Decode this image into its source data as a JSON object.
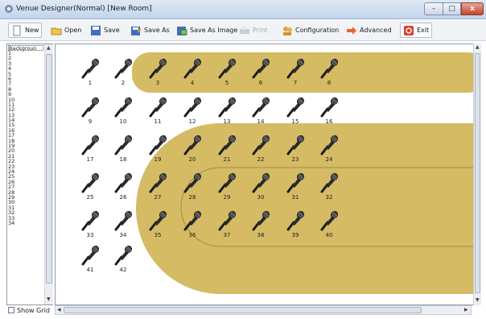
{
  "window": {
    "title": "Venue Designer(Normal) [New Room]",
    "min_label": "–",
    "max_label": "□",
    "close_label": "x"
  },
  "toolbar": [
    {
      "label": "New",
      "icon": "new-document-icon",
      "name": "new-button",
      "boxed": true
    },
    {
      "label": "Open",
      "icon": "open-folder-icon",
      "name": "open-button",
      "boxed": false
    },
    {
      "label": "Save",
      "icon": "save-disk-icon",
      "name": "save-button",
      "boxed": false
    },
    {
      "label": "Save As",
      "icon": "save-as-icon",
      "name": "save-as-button",
      "boxed": false
    },
    {
      "label": "Save As Image",
      "icon": "save-as-image-icon",
      "name": "save-as-image-button",
      "boxed": false
    },
    {
      "label": "Print",
      "icon": "printer-icon",
      "name": "print-button",
      "boxed": false,
      "disabled": true
    },
    {
      "label": "Configuration",
      "icon": "configuration-people-icon",
      "name": "configuration-button",
      "boxed": false
    },
    {
      "label": "Advanced",
      "icon": "arrow-right-icon",
      "name": "advanced-button",
      "boxed": false
    },
    {
      "label": "Exit",
      "icon": "exit-power-icon",
      "name": "exit-button",
      "boxed": true
    }
  ],
  "left_list": {
    "header": "Backgroun",
    "items": [
      "1",
      "2",
      "3",
      "4",
      "5",
      "6",
      "7",
      "8",
      "9",
      "10",
      "11",
      "12",
      "13",
      "14",
      "15",
      "16",
      "17",
      "18",
      "19",
      "20",
      "21",
      "22",
      "23",
      "24",
      "25",
      "26",
      "27",
      "28",
      "29",
      "30",
      "31",
      "32",
      "33",
      "34"
    ]
  },
  "show_grid": {
    "label": "Show Grid",
    "checked": false
  },
  "canvas": {
    "background_color": "#d4bb64",
    "outline_color": "#a48d42",
    "microphones": [
      "1",
      "2",
      "3",
      "4",
      "5",
      "6",
      "7",
      "8",
      "9",
      "10",
      "11",
      "12",
      "13",
      "14",
      "15",
      "16",
      "17",
      "18",
      "19",
      "20",
      "21",
      "22",
      "23",
      "24",
      "25",
      "26",
      "27",
      "28",
      "29",
      "30",
      "31",
      "32",
      "33",
      "34",
      "35",
      "36",
      "37",
      "38",
      "39",
      "40",
      "41",
      "42"
    ]
  }
}
